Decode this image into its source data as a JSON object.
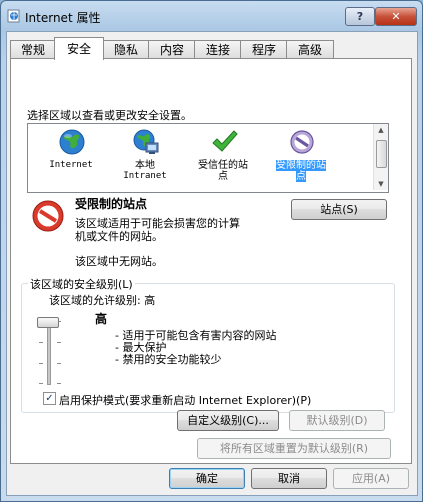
{
  "window": {
    "title": "Internet 属性",
    "help_label": "?",
    "close_label": "✕"
  },
  "tabs": [
    {
      "label": "常规"
    },
    {
      "label": "安全"
    },
    {
      "label": "隐私"
    },
    {
      "label": "内容"
    },
    {
      "label": "连接"
    },
    {
      "label": "程序"
    },
    {
      "label": "高级"
    }
  ],
  "security": {
    "instruction": "选择区域以查看或更改安全设置。",
    "zones": [
      {
        "label_1": "Internet",
        "label_2": "",
        "icon": "globe-icon"
      },
      {
        "label_1": "本地",
        "label_2": "Intranet",
        "icon": "intranet-icon"
      },
      {
        "label_1": "受信任的站",
        "label_2": "点",
        "icon": "trusted-checkmark-icon"
      },
      {
        "label_1": "受限制的站",
        "label_2": "点",
        "icon": "restricted-sites-icon"
      }
    ],
    "selected_zone": {
      "title": "受限制的站点",
      "desc_1": "该区域适用于可能会损害您的计算",
      "desc_2": "机或文件的网站。",
      "desc_3": "该区域中无网站。",
      "sites_button": "站点(S)"
    },
    "level_group": {
      "title": "该区域的安全级别(L)",
      "allowed": "该区域的允许级别: 高",
      "level_name": "高",
      "bullets": [
        "- 适用于可能包含有害内容的网站",
        "- 最大保护",
        "- 禁用的安全功能较少"
      ],
      "protected_mode": "启用保护模式(要求重新启动 Internet Explorer)(P)",
      "protected_mode_checked": true,
      "custom_button": "自定义级别(C)...",
      "default_button": "默认级别(D)"
    },
    "reset_all_button": "将所有区域重置为默认级别(R)"
  },
  "footer": {
    "ok": "确定",
    "cancel": "取消",
    "apply": "应用(A)"
  }
}
